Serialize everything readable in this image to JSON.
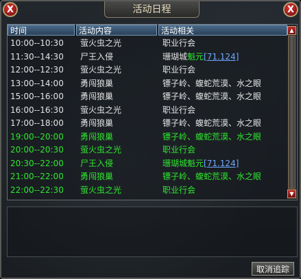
{
  "window": {
    "title": "活动日程",
    "left_icon": "X",
    "close_icon": "X"
  },
  "columns": [
    "时间",
    "活动内容",
    "活动相关"
  ],
  "rows": [
    {
      "time": "10:00--10:30",
      "content": "萤火虫之光",
      "related": "职业行会",
      "active": false
    },
    {
      "time": "11:30--14:30",
      "content": "尸王入侵",
      "related_prefix": "珊瑚城",
      "related_link_green": "魁元",
      "related_link_blue": "[71.124]",
      "active": false
    },
    {
      "time": "12:00--12:30",
      "content": "萤火虫之光",
      "related": "职业行会",
      "active": false
    },
    {
      "time": "13:00--14:00",
      "content": "勇闯狼巢",
      "related": "镖子岭、蝮蛇荒漠、水之眼",
      "active": false
    },
    {
      "time": "15:00--16:00",
      "content": "勇闯狼巢",
      "related": "镖子岭、蝮蛇荒漠、水之眼",
      "active": false
    },
    {
      "time": "16:00--16:30",
      "content": "萤火虫之光",
      "related": "职业行会",
      "active": false
    },
    {
      "time": "17:00--18:00",
      "content": "勇闯狼巢",
      "related": "镖子岭、蝮蛇荒漠、水之眼",
      "active": false
    },
    {
      "time": "19:00--20:00",
      "content": "勇闯狼巢",
      "related": "镖子岭、蝮蛇荒漠、水之眼",
      "active": true
    },
    {
      "time": "20:00--20:30",
      "content": "萤火虫之光",
      "related": "职业行会",
      "active": true
    },
    {
      "time": "20:30--22:00",
      "content": "尸王入侵",
      "related_prefix": "珊瑚城",
      "related_link_green": "魁元",
      "related_link_blue": "[71.124]",
      "active": true
    },
    {
      "time": "21:00--22:00",
      "content": "勇闯狼巢",
      "related": "镖子岭、蝮蛇荒漠、水之眼",
      "active": true
    },
    {
      "time": "22:00--22:30",
      "content": "萤火虫之光",
      "related": "职业行会",
      "active": true
    }
  ],
  "cancel_button": "取消追踪",
  "colors": {
    "active_green": "#2ee82e",
    "link_blue": "#6fa8ff",
    "header_blue": "#3a5a78"
  }
}
